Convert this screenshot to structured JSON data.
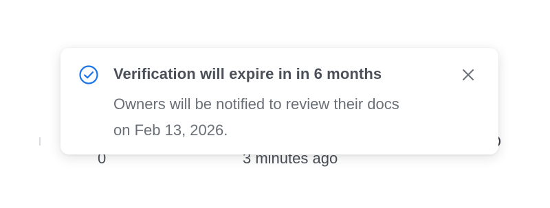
{
  "background": {
    "count_value": "0",
    "timestamp": "3 minutes ago"
  },
  "toast": {
    "icon": "check-circle-icon",
    "title": "Verification will expire in in 6 months",
    "body": "Owners will be notified to review their docs on Feb 13, 2026.",
    "close_icon": "close-icon",
    "accent_color": "#1a73e8"
  }
}
